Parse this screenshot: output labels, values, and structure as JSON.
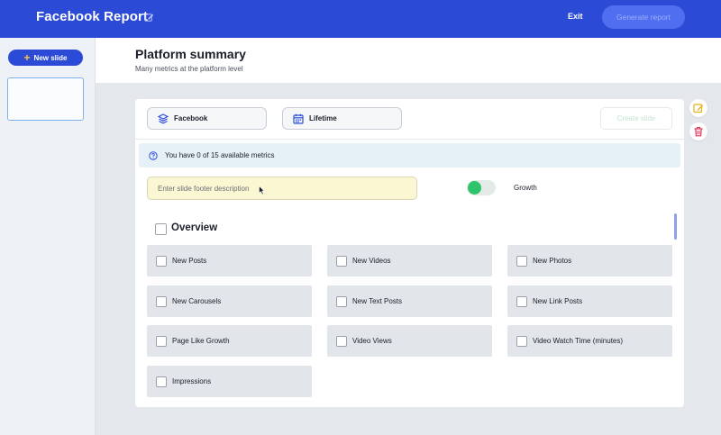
{
  "header": {
    "app_title": "Facebook Report",
    "exit_label": "Exit",
    "generate_label": "Generate report"
  },
  "sidebar": {
    "new_slide_label": "New slide"
  },
  "page": {
    "title": "Platform summary",
    "subtitle": "Many metrics at the platform level"
  },
  "toolbar": {
    "platform_label": "Facebook",
    "period_label": "Lifetime",
    "create_slide_label": "Create slide"
  },
  "info": {
    "text": "You have 0 of 15 available metrics"
  },
  "footer_field": {
    "placeholder": "Enter slide footer description",
    "value": ""
  },
  "growth_toggle": {
    "label": "Growth",
    "on": true
  },
  "section": {
    "title": "Overview",
    "metrics": [
      "New Posts",
      "New Videos",
      "New Photos",
      "New Carousels",
      "New Text Posts",
      "New Link Posts",
      "Page Like Growth",
      "Video Views",
      "Video Watch Time (minutes)",
      "Impressions"
    ]
  },
  "colors": {
    "brand": "#2b4bd6",
    "toggle_on": "#2ec46b",
    "footer_field_bg": "#fbf7d2",
    "edit_icon": "#e8b21a",
    "trash_icon": "#e0335a"
  },
  "icons": {
    "title_edit": "edit-icon",
    "platform": "layers-icon",
    "period": "calendar-icon",
    "info": "question-circle-icon",
    "tool_edit": "edit-icon",
    "tool_delete": "trash-icon"
  }
}
